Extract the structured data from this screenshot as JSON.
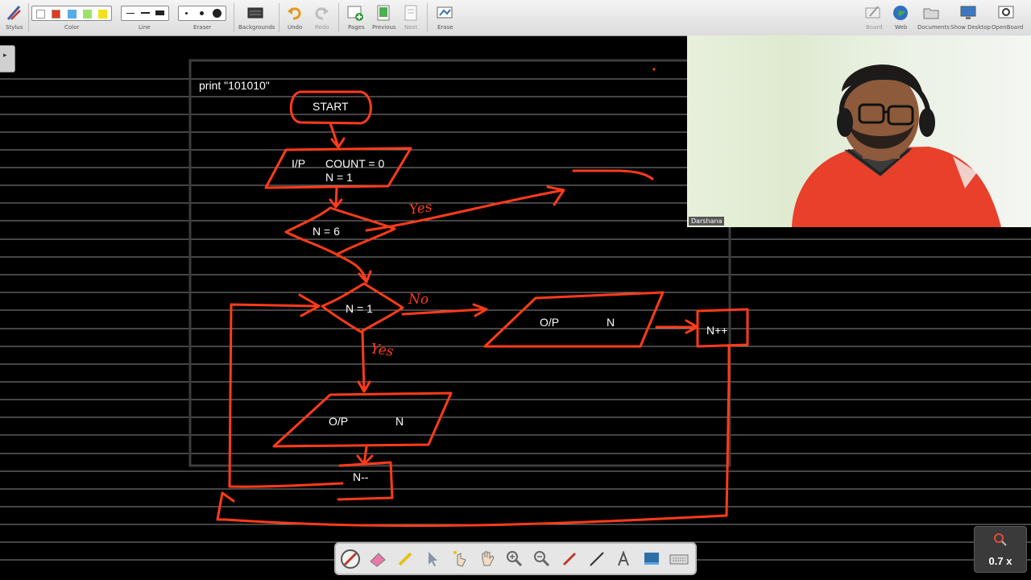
{
  "toolbar": {
    "stylus": "Stylus",
    "color": "Color",
    "line": "Line",
    "eraser": "Eraser",
    "backgrounds": "Backgrounds",
    "undo": "Undo",
    "redo": "Redo",
    "pages": "Pages",
    "previous": "Previous",
    "next": "Next",
    "erase": "Erase",
    "board": "Board",
    "web": "Web",
    "documents": "Documents",
    "show_desktop": "Show Desktop",
    "openboard": "OpenBoard"
  },
  "colors": {
    "swatches": [
      "#ffffff",
      "#e23b1e",
      "#55aee8",
      "#9ee26a",
      "#f2e21b"
    ],
    "ink": "#ff3b1a",
    "board_bg": "#000000",
    "ruling": "#8a8a8a"
  },
  "flowchart": {
    "print_caption": "print \"101010\"",
    "start": "START",
    "input_label": "I/P",
    "count_init": "COUNT = 0",
    "n_init": "N = 1",
    "cond1": "N = 6",
    "cond1_yes": "Yes",
    "cond2": "N = 1",
    "cond2_no": "No",
    "cond2_yes": "Yes",
    "output_right_label": "O/P",
    "output_right_value": "N",
    "increment": "N++",
    "output_bottom_label": "O/P",
    "output_bottom_value": "N",
    "decrement": "N--"
  },
  "webcam": {
    "participant_name": "Darshana"
  },
  "zoom": {
    "value": "0.7 x"
  },
  "dock": {
    "tools": [
      "pen-icon",
      "eraser-icon",
      "marker-icon",
      "selector-icon",
      "interactor-icon",
      "hand-icon",
      "zoom-in-icon",
      "zoom-out-icon",
      "laser-pointer-icon",
      "line-icon",
      "text-icon",
      "capture-icon",
      "keyboard-icon"
    ]
  }
}
